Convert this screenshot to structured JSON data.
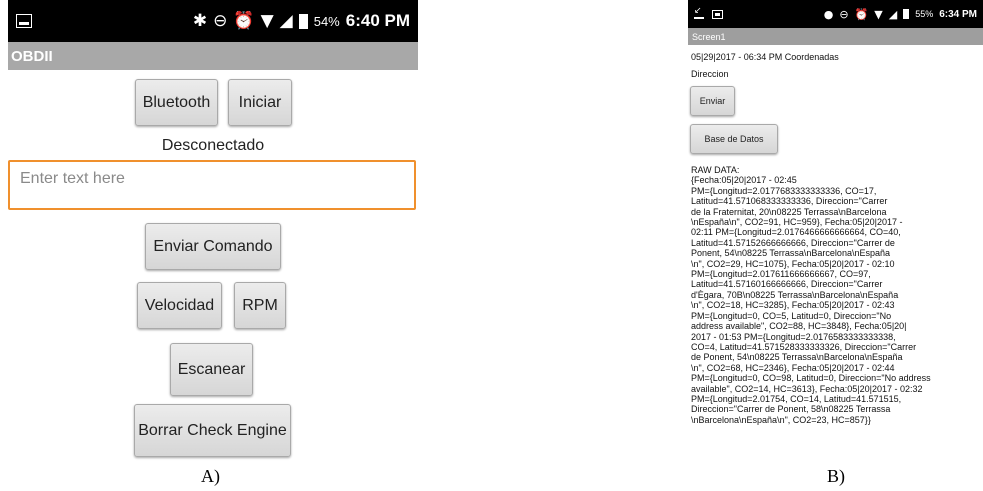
{
  "phoneA": {
    "status_bar": {
      "left_icon": "image-icon",
      "icons": [
        "bluetooth-icon",
        "do-not-disturb-icon",
        "alarm-icon",
        "wifi-icon",
        "signal-icon",
        "battery-icon"
      ],
      "battery_pct": "54%",
      "time": "6:40 PM"
    },
    "title": "OBDII",
    "buttons": {
      "bluetooth": "Bluetooth",
      "iniciar": "Iniciar",
      "enviar_comando": "Enviar Comando",
      "velocidad": "Velocidad",
      "rpm": "RPM",
      "escanear": "Escanear",
      "borrar": "Borrar Check Engine"
    },
    "status_text": "Desconectado",
    "input": {
      "placeholder": "Enter text here",
      "value": ""
    }
  },
  "phoneB": {
    "status_bar": {
      "left_icons": [
        "download-icon",
        "image-icon"
      ],
      "icons": [
        "location-icon",
        "do-not-disturb-icon",
        "alarm-icon",
        "wifi-icon",
        "signal-icon",
        "battery-icon"
      ],
      "battery_pct": "55%",
      "time": "6:34 PM"
    },
    "title": "Screen1",
    "datetime_line": "05|29|2017 - 06:34 PM Coordenadas",
    "direccion_label": "Direccion",
    "buttons": {
      "enviar": "Enviar",
      "base_datos": "Base de Datos"
    },
    "raw_data": "RAW DATA:\n{Fecha:05|20|2017 - 02:45\nPM={Longitud=2.0177683333333336, CO=17,\nLatitud=41.571068333333336, Direccion=\"Carrer\nde la Fraternitat, 20\\n08225 Terrassa\\nBarcelona\n\\nEspaña\\n\", CO2=91, HC=959}, Fecha:05|20|2017 -\n02:11 PM={Longitud=2.0176466666666664, CO=40,\nLatitud=41.57152666666666, Direccion=\"Carrer de\nPonent, 54\\n08225 Terrassa\\nBarcelona\\nEspaña\n\\n\", CO2=29, HC=1075}, Fecha:05|20|2017 - 02:10\nPM={Longitud=2.017611666666667, CO=97,\nLatitud=41.57160166666666, Direccion=\"Carrer\nd'Ègara, 70B\\n08225 Terrassa\\nBarcelona\\nEspaña\n\\n\", CO2=18, HC=3285}, Fecha:05|20|2017 - 02:43\nPM={Longitud=0, CO=5, Latitud=0, Direccion=\"No\naddress available\", CO2=88, HC=3848}, Fecha:05|20|\n2017 - 01:53 PM={Longitud=2.0176583333333338,\nCO=4, Latitud=41.571528333333326, Direccion=\"Carrer\nde Ponent, 54\\n08225 Terrassa\\nBarcelona\\nEspaña\n\\n\", CO2=68, HC=2346}, Fecha:05|20|2017 - 02:44\nPM={Longitud=0, CO=98, Latitud=0, Direccion=\"No address\navailable\", CO2=14, HC=3613}, Fecha:05|20|2017 - 02:32\nPM={Longitud=2.01754, CO=14, Latitud=41.571515,\nDireccion=\"Carrer de Ponent, 58\\n08225 Terrassa\n\\nBarcelona\\nEspaña\\n\", CO2=23, HC=857}}"
  },
  "captions": {
    "a": "A)",
    "b": "B)"
  },
  "colors": {
    "input_border": "#f0902d",
    "titlebar": "#a8a8a8",
    "statusbar": "#000000"
  }
}
